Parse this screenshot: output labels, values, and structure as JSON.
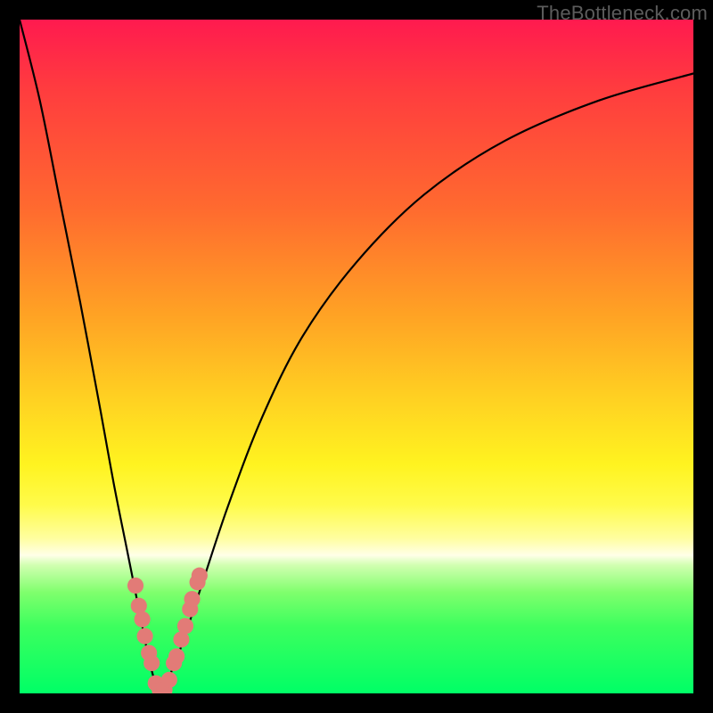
{
  "watermark": {
    "text": "TheBottleneck.com"
  },
  "chart_data": {
    "type": "line",
    "title": "",
    "xlabel": "",
    "ylabel": "",
    "xlim": [
      0,
      100
    ],
    "ylim": [
      0,
      100
    ],
    "background_gradient": {
      "orientation": "vertical",
      "stops": [
        {
          "pos": 0,
          "color": "#ff1a4f"
        },
        {
          "pos": 0.28,
          "color": "#ff6a2f"
        },
        {
          "pos": 0.56,
          "color": "#ffd022"
        },
        {
          "pos": 0.8,
          "color": "#ffffe8"
        },
        {
          "pos": 1.0,
          "color": "#00ff66"
        }
      ]
    },
    "series": [
      {
        "name": "bottleneck-curve",
        "x": [
          0,
          3,
          6,
          9,
          12,
          14,
          16,
          18,
          19,
          20,
          21,
          22,
          24,
          27,
          31,
          36,
          42,
          50,
          60,
          72,
          86,
          100
        ],
        "values": [
          100,
          88,
          73,
          58,
          42,
          31,
          21,
          11,
          6,
          2,
          0,
          2,
          7,
          16,
          28,
          41,
          53,
          64,
          74,
          82,
          88,
          92
        ]
      }
    ],
    "curve_minimum": {
      "x": 21,
      "value": 0
    },
    "markers": {
      "color": "#e27b77",
      "radius_approx": 1.2,
      "points": [
        {
          "x": 17.2,
          "value": 16.0
        },
        {
          "x": 17.7,
          "value": 13.0
        },
        {
          "x": 18.2,
          "value": 11.0
        },
        {
          "x": 18.6,
          "value": 8.5
        },
        {
          "x": 19.2,
          "value": 6.0
        },
        {
          "x": 19.6,
          "value": 4.5
        },
        {
          "x": 20.2,
          "value": 1.5
        },
        {
          "x": 20.8,
          "value": 0.5
        },
        {
          "x": 21.5,
          "value": 0.5
        },
        {
          "x": 22.2,
          "value": 2.0
        },
        {
          "x": 22.9,
          "value": 4.5
        },
        {
          "x": 23.3,
          "value": 5.5
        },
        {
          "x": 24.0,
          "value": 8.0
        },
        {
          "x": 24.6,
          "value": 10.0
        },
        {
          "x": 25.3,
          "value": 12.5
        },
        {
          "x": 25.6,
          "value": 14.0
        },
        {
          "x": 26.4,
          "value": 16.5
        },
        {
          "x": 26.7,
          "value": 17.5
        }
      ]
    }
  }
}
